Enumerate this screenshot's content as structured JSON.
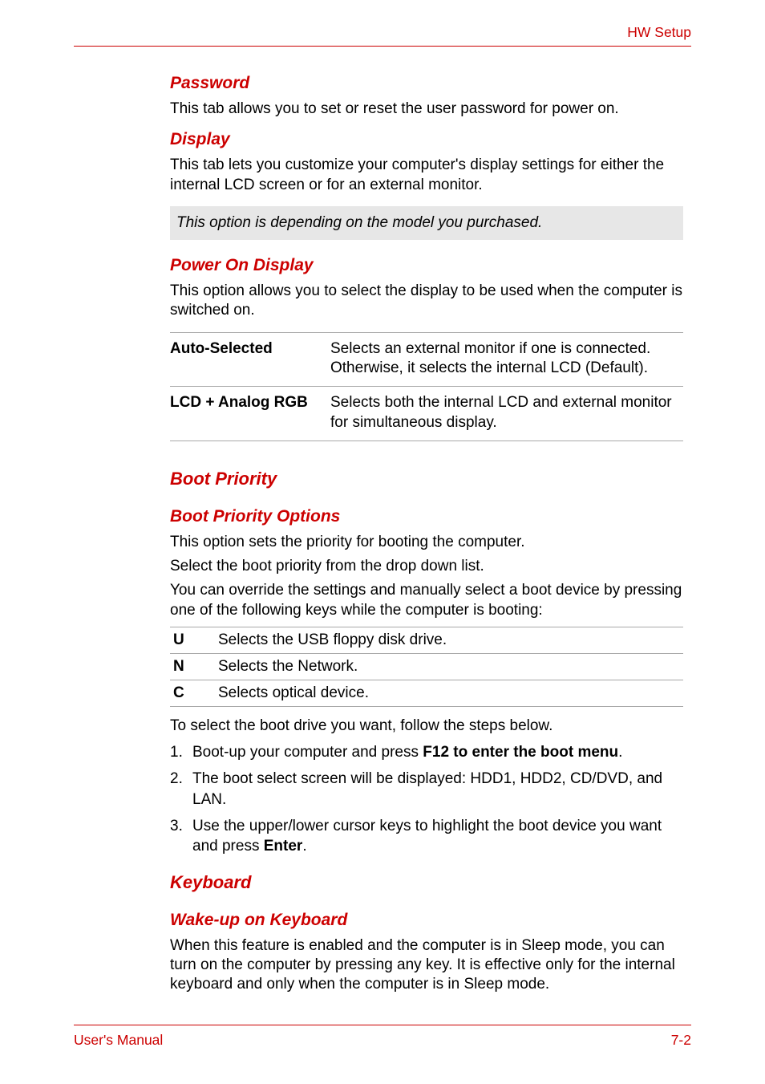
{
  "header": {
    "label": "HW Setup"
  },
  "sections": {
    "password": {
      "title": "Password",
      "body": "This tab allows you to set or reset the user password for power on."
    },
    "display": {
      "title": "Display",
      "body": "This tab lets you customize your computer's display settings for either the internal LCD screen or for an external monitor.",
      "note": "This option is depending on the model you purchased."
    },
    "power_on_display": {
      "title": "Power On Display",
      "body": "This option allows you to select the display to be used when the computer is switched on.",
      "rows": [
        {
          "key": "Auto-Selected",
          "desc": "Selects an external monitor if one is connected. Otherwise, it selects the internal LCD (Default)."
        },
        {
          "key": "LCD + Analog RGB",
          "desc": "Selects both the internal LCD and external monitor for simultaneous display."
        }
      ]
    },
    "boot_priority": {
      "title": "Boot Priority",
      "options_title": "Boot Priority Options",
      "p1": "This option sets the priority for booting the computer.",
      "p2": "Select the boot priority from the drop down list.",
      "p3": "You can override the settings and manually select a boot device by pressing one of the following keys while the computer is booting:",
      "keys": [
        {
          "k": "U",
          "d": "Selects the USB floppy disk drive."
        },
        {
          "k": "N",
          "d": "Selects the Network."
        },
        {
          "k": "C",
          "d": "Selects optical device."
        }
      ],
      "p4": "To select the boot drive you want, follow the steps below.",
      "list": [
        {
          "n": "1.",
          "pre": "Boot-up your computer and press ",
          "bold": "F12 to enter the boot menu",
          "post": "."
        },
        {
          "n": "2.",
          "pre": "The boot select screen will be displayed: HDD1, HDD2, CD/DVD, and LAN.",
          "bold": "",
          "post": ""
        },
        {
          "n": "3.",
          "pre": "Use the upper/lower cursor keys to highlight the boot device you want and press ",
          "bold": "Enter",
          "post": "."
        }
      ]
    },
    "keyboard": {
      "title": "Keyboard",
      "sub_title": "Wake-up on Keyboard",
      "body": "When this feature is enabled and the computer is in Sleep mode, you can turn on the computer by pressing any key. It is effective only for the internal keyboard and only when the computer is in Sleep mode."
    }
  },
  "footer": {
    "left": "User's Manual",
    "right": "7-2"
  }
}
